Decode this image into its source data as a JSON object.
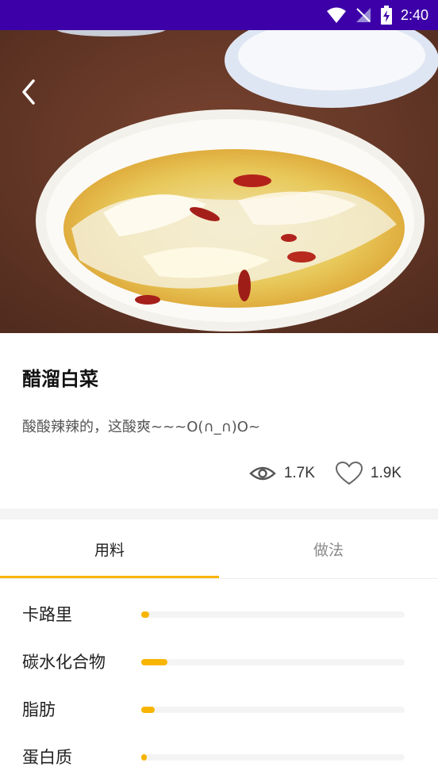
{
  "status_bar": {
    "time": "2:40"
  },
  "recipe": {
    "title": "醋溜白菜",
    "description": "酸酸辣辣的，这酸爽~~~O(∩_∩)O~",
    "views": "1.7K",
    "likes": "1.9K"
  },
  "tabs": [
    {
      "label": "用料",
      "active": true
    },
    {
      "label": "做法",
      "active": false
    }
  ],
  "nutrition": [
    {
      "label": "卡路里",
      "fraction": 0.03
    },
    {
      "label": "碳水化合物",
      "fraction": 0.1
    },
    {
      "label": "脂肪",
      "fraction": 0.05
    },
    {
      "label": "蛋白质",
      "fraction": 0.02
    }
  ],
  "colors": {
    "accent": "#f8b500",
    "status_bar": "#3d00a8"
  }
}
